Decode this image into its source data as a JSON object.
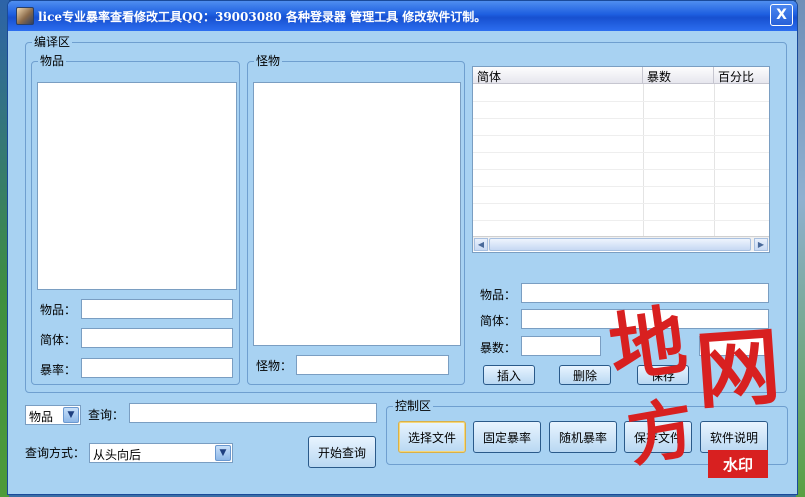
{
  "window": {
    "title": "lice专业暴率查看修改工具QQ：39003080   各种登录器 管理工具 修改软件订制。",
    "close_symbol": "X"
  },
  "edit_area": {
    "legend": "编译区",
    "items_group": {
      "legend": "物品",
      "item_label": "物品：",
      "simplified_label": "简体：",
      "rate_label": "暴率："
    },
    "monster_group": {
      "legend": "怪物",
      "monster_label": "怪物："
    },
    "grid": {
      "columns": [
        "简体",
        "暴数",
        "百分比"
      ]
    },
    "right_fields": {
      "item_label": "物品：",
      "simplified_label": "简体：",
      "drops_label": "暴数："
    },
    "buttons": {
      "insert": "插入",
      "delete": "删除",
      "save": "保存"
    }
  },
  "search": {
    "type_value": "物品",
    "query_label": "查询：",
    "mode_label": "查询方式：",
    "mode_value": "从头向后",
    "start_button": "开始查询"
  },
  "control_area": {
    "legend": "控制区",
    "buttons": {
      "select_file": "选择文件",
      "fixed_rate": "固定暴率",
      "random_rate": "随机暴率",
      "save_file": "保存文件",
      "manual": "软件说明"
    }
  },
  "watermark": {
    "chars": [
      "地",
      "网",
      "方"
    ],
    "badge": "水印"
  },
  "icons": {
    "app": "app-portrait-icon",
    "dropdown": "chevron-down-icon",
    "scroll_left": "arrow-left-icon",
    "scroll_right": "arrow-right-icon"
  }
}
